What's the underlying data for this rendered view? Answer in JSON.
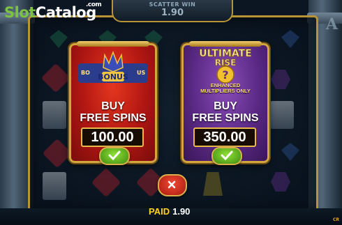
{
  "watermark": {
    "slot": "Slot",
    "catalog": "Catalog",
    "domain": ".com"
  },
  "scatter_win": {
    "label": "SCATTER WIN",
    "value": "1.90"
  },
  "side_letter": "A",
  "bottom_corner": "CR",
  "panels": [
    {
      "id": "bonus",
      "art_text": "BONUS",
      "art_side_left": "BO",
      "art_side_right": "US",
      "line1": "BUY",
      "line2": "FREE SPINS",
      "price": "100.00",
      "color": "#c11f16"
    },
    {
      "id": "ultimate",
      "title_line1": "ULTIMATE",
      "title_line2": "RISE",
      "badge": "?",
      "note_line1": "ENHANCED",
      "note_line2": "MULTIPLIERS ONLY",
      "line1": "BUY",
      "line2": "FREE SPINS",
      "price": "350.00",
      "color": "#6a3296"
    }
  ],
  "paid": {
    "label": "PAID",
    "value": "1.90"
  },
  "icons": {
    "confirm": "checkmark-icon",
    "close": "close-x-icon"
  },
  "colors": {
    "gold": "#d4a640",
    "paid_label": "#ffd21f",
    "logo_green": "#7ec242"
  }
}
